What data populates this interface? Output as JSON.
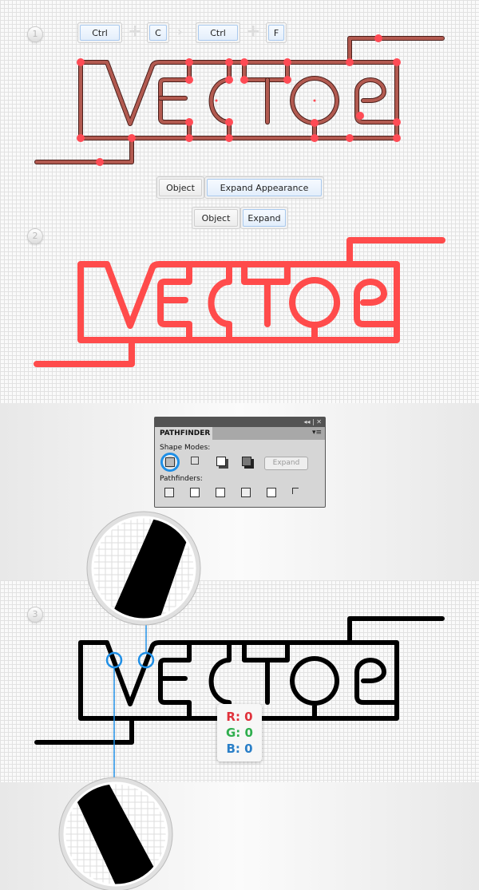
{
  "steps": [
    "1",
    "2",
    "3"
  ],
  "step1": {
    "keys": [
      "Ctrl",
      "C",
      "Ctrl",
      "F"
    ]
  },
  "menu1": {
    "object": "Object",
    "command": "Expand Appearance"
  },
  "menu2": {
    "object": "Object",
    "command": "Expand"
  },
  "pathfinder": {
    "title": "PATHFINDER",
    "shape_modes_label": "Shape Modes:",
    "pathfinders_label": "Pathfinders:",
    "expand_label": "Expand",
    "collapse_icon": "◂◂",
    "close_icon": "✕",
    "menu_icon": "▾≡",
    "selected_mode": "unite"
  },
  "color_readout": {
    "r": "R: 0",
    "g": "G: 0",
    "b": "B: 0",
    "r_color": "#e0323c",
    "g_color": "#2fae4e",
    "b_color": "#2a7fc8"
  },
  "colors": {
    "outline": "#8b3a33",
    "anchor": "#ff4b55",
    "expanded": "#ff4b4b",
    "final": "#000000",
    "highlight": "#1f8fe6"
  }
}
